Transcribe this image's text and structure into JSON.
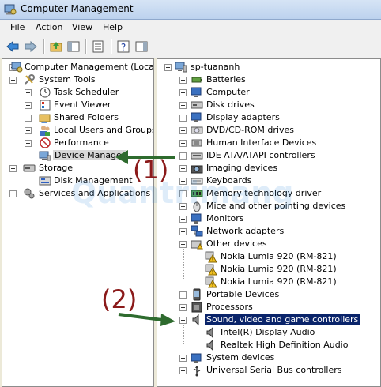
{
  "window": {
    "title": "Computer Management"
  },
  "menu": [
    "File",
    "Action",
    "View",
    "Help"
  ],
  "toolbar": {
    "buttons": [
      "back-icon",
      "forward-icon",
      "up-folder-icon",
      "show-hide-tree-icon",
      "properties-icon",
      "help-icon",
      "show-hide-action-pane-icon"
    ]
  },
  "left_tree": [
    {
      "label": "Computer Management (Local)",
      "icon": "computer-management-icon"
    },
    {
      "label": "System Tools",
      "icon": "tools-icon"
    },
    {
      "label": "Task Scheduler",
      "icon": "clock-icon"
    },
    {
      "label": "Event Viewer",
      "icon": "event-viewer-icon"
    },
    {
      "label": "Shared Folders",
      "icon": "shared-folder-icon"
    },
    {
      "label": "Local Users and Groups",
      "icon": "users-icon"
    },
    {
      "label": "Performance",
      "icon": "performance-icon"
    },
    {
      "label": "Device Manager",
      "icon": "device-manager-icon",
      "selected": true
    },
    {
      "label": "Storage",
      "icon": "storage-icon"
    },
    {
      "label": "Disk Management",
      "icon": "disk-icon"
    },
    {
      "label": "Services and Applications",
      "icon": "services-icon"
    }
  ],
  "right_tree": {
    "root": "sp-tuananh",
    "items": [
      {
        "label": "Batteries",
        "icon": "battery-icon"
      },
      {
        "label": "Computer",
        "icon": "computer-icon"
      },
      {
        "label": "Disk drives",
        "icon": "disk-drive-icon"
      },
      {
        "label": "Display adapters",
        "icon": "monitor-icon"
      },
      {
        "label": "DVD/CD-ROM drives",
        "icon": "dvd-icon"
      },
      {
        "label": "Human Interface Devices",
        "icon": "hid-icon"
      },
      {
        "label": "IDE ATA/ATAPI controllers",
        "icon": "ide-icon"
      },
      {
        "label": "Imaging devices",
        "icon": "camera-icon"
      },
      {
        "label": "Keyboards",
        "icon": "keyboard-icon"
      },
      {
        "label": "Memory technology driver",
        "icon": "memory-icon"
      },
      {
        "label": "Mice and other pointing devices",
        "icon": "mouse-icon"
      },
      {
        "label": "Monitors",
        "icon": "monitor-icon"
      },
      {
        "label": "Network adapters",
        "icon": "network-icon"
      },
      {
        "label": "Other devices",
        "icon": "other-devices-icon"
      },
      {
        "label": "Nokia Lumia 920 (RM-821)",
        "icon": "warning-icon"
      },
      {
        "label": "Nokia Lumia 920 (RM-821)",
        "icon": "warning-icon"
      },
      {
        "label": "Nokia Lumia 920 (RM-821)",
        "icon": "warning-icon"
      },
      {
        "label": "Portable Devices",
        "icon": "portable-icon"
      },
      {
        "label": "Processors",
        "icon": "processor-icon"
      },
      {
        "label": "Sound, video and game controllers",
        "icon": "speaker-icon",
        "selected": true
      },
      {
        "label": "Intel(R) Display Audio",
        "icon": "speaker-icon"
      },
      {
        "label": "Realtek High Definition Audio",
        "icon": "speaker-icon"
      },
      {
        "label": "System devices",
        "icon": "system-icon"
      },
      {
        "label": "Universal Serial Bus controllers",
        "icon": "usb-icon"
      }
    ]
  },
  "callouts": [
    "(1)",
    "(2)"
  ],
  "watermark": "Quantrimang",
  "colors": {
    "arrow": "#2e6b2e",
    "callout": "#8b1a1a",
    "selection": "#0a246a"
  }
}
